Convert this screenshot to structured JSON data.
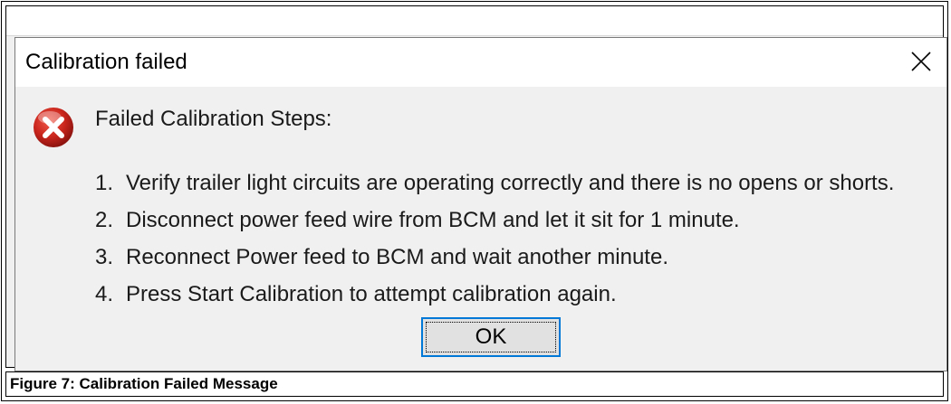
{
  "dialog": {
    "title": "Calibration failed",
    "heading": "Failed Calibration Steps:",
    "steps": [
      {
        "num": "1.",
        "text": "Verify trailer light circuits are operating correctly and there is no opens or shorts."
      },
      {
        "num": "2.",
        "text": "Disconnect power feed wire from BCM and let it sit for 1 minute."
      },
      {
        "num": "3.",
        "text": "Reconnect Power feed to BCM and wait another minute."
      },
      {
        "num": "4.",
        "text": "Press Start Calibration to attempt calibration again."
      }
    ],
    "ok_label": "OK",
    "icon": "error-icon"
  },
  "figure": {
    "caption": "Figure 7: Calibration Failed Message"
  }
}
